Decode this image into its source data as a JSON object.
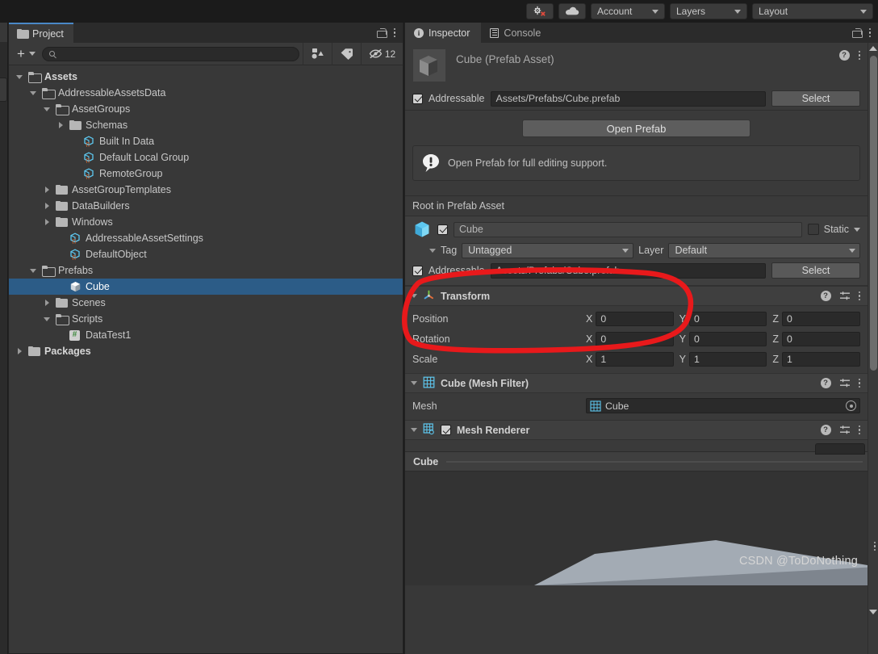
{
  "toolbar": {
    "cloud_icon": "cloud-icon",
    "collab_icon": "collab-error-icon",
    "account_label": "Account",
    "layers_label": "Layers",
    "layout_label": "Layout"
  },
  "project_panel": {
    "tab_label": "Project",
    "tab_icon": "folder-icon",
    "lock_icon": "lock-icon",
    "menu_icon": "kebab-menu-icon",
    "create_label": "+",
    "search": {
      "value": "",
      "placeholder": "",
      "icon": "search-icon"
    },
    "filter_type_icon": "filter-by-type-icon",
    "filter_label_icon": "filter-by-label-icon",
    "hidden_icon": "hidden-eye-icon",
    "hidden_count": "12",
    "tree": [
      {
        "label": "Assets",
        "depth": 0,
        "twisty": "down",
        "icon": "folder-open-icon",
        "bold": true,
        "selected": false
      },
      {
        "label": "AddressableAssetsData",
        "depth": 1,
        "twisty": "down",
        "icon": "folder-open-icon",
        "bold": false,
        "selected": false
      },
      {
        "label": "AssetGroups",
        "depth": 2,
        "twisty": "down",
        "icon": "folder-open-icon",
        "bold": false,
        "selected": false
      },
      {
        "label": "Schemas",
        "depth": 3,
        "twisty": "right",
        "icon": "folder-icon",
        "bold": false,
        "selected": false
      },
      {
        "label": "Built In Data",
        "depth": 4,
        "twisty": "none",
        "icon": "scriptable-object-icon",
        "bold": false,
        "selected": false
      },
      {
        "label": "Default Local Group",
        "depth": 4,
        "twisty": "none",
        "icon": "scriptable-object-icon",
        "bold": false,
        "selected": false
      },
      {
        "label": "RemoteGroup",
        "depth": 4,
        "twisty": "none",
        "icon": "scriptable-object-icon",
        "bold": false,
        "selected": false
      },
      {
        "label": "AssetGroupTemplates",
        "depth": 2,
        "twisty": "right",
        "icon": "folder-icon",
        "bold": false,
        "selected": false
      },
      {
        "label": "DataBuilders",
        "depth": 2,
        "twisty": "right",
        "icon": "folder-icon",
        "bold": false,
        "selected": false
      },
      {
        "label": "Windows",
        "depth": 2,
        "twisty": "right",
        "icon": "folder-icon",
        "bold": false,
        "selected": false
      },
      {
        "label": "AddressableAssetSettings",
        "depth": 3,
        "twisty": "none",
        "icon": "scriptable-object-icon",
        "bold": false,
        "selected": false
      },
      {
        "label": "DefaultObject",
        "depth": 3,
        "twisty": "none",
        "icon": "scriptable-object-icon",
        "bold": false,
        "selected": false
      },
      {
        "label": "Prefabs",
        "depth": 1,
        "twisty": "down",
        "icon": "folder-open-icon",
        "bold": false,
        "selected": false
      },
      {
        "label": "Cube",
        "depth": 3,
        "twisty": "none",
        "icon": "prefab-cube-icon",
        "bold": false,
        "selected": true
      },
      {
        "label": "Scenes",
        "depth": 2,
        "twisty": "right",
        "icon": "folder-icon",
        "bold": false,
        "selected": false
      },
      {
        "label": "Scripts",
        "depth": 2,
        "twisty": "down",
        "icon": "folder-open-icon",
        "bold": false,
        "selected": false
      },
      {
        "label": "DataTest1",
        "depth": 3,
        "twisty": "none",
        "icon": "csharp-script-icon",
        "bold": false,
        "selected": false
      },
      {
        "label": "Packages",
        "depth": 0,
        "twisty": "right",
        "icon": "folder-icon",
        "bold": true,
        "selected": false
      }
    ]
  },
  "inspector": {
    "tabs": [
      {
        "label": "Inspector",
        "icon": "info-icon",
        "active": true
      },
      {
        "label": "Console",
        "icon": "console-icon",
        "active": false
      }
    ],
    "lock_icon": "lock-icon",
    "menu_icon": "kebab-menu-icon",
    "asset_header": {
      "title": "Cube (Prefab Asset)",
      "thumbnail": "cube-thumbnail",
      "help_icon": "help-icon",
      "menu_icon": "kebab-menu-icon"
    },
    "asset_addressable": {
      "checked": true,
      "label": "Addressable",
      "path": "Assets/Prefabs/Cube.prefab",
      "select_label": "Select"
    },
    "prefab_section": {
      "open_prefab_label": "Open Prefab",
      "help_icon": "warning-icon",
      "help_text": "Open Prefab for full editing support."
    },
    "root_label": "Root in Prefab Asset",
    "gameobject": {
      "icon": "prefab-cube-icon",
      "enabled": true,
      "name": "Cube",
      "static_label": "Static",
      "static_checked": false,
      "tag_label": "Tag",
      "tag_value": "Untagged",
      "layer_label": "Layer",
      "layer_value": "Default",
      "addressable": {
        "checked": true,
        "label": "Addressable",
        "path": "Assets/Prefabs/Cube.prefab",
        "select_label": "Select"
      }
    },
    "components": [
      {
        "name": "Transform",
        "icon": "transform-axis-icon",
        "help_icon": "help-icon",
        "preset_icon": "preset-icon",
        "menu_icon": "kebab-menu-icon",
        "rows": [
          {
            "label": "Position",
            "x": "0",
            "y": "0",
            "z": "0"
          },
          {
            "label": "Rotation",
            "x": "0",
            "y": "0",
            "z": "0"
          },
          {
            "label": "Scale",
            "x": "1",
            "y": "1",
            "z": "1"
          }
        ],
        "axis_labels": {
          "x": "X",
          "y": "Y",
          "z": "Z"
        }
      },
      {
        "name": "Cube (Mesh Filter)",
        "icon": "mesh-filter-icon",
        "help_icon": "help-icon",
        "preset_icon": "preset-icon",
        "menu_icon": "kebab-menu-icon",
        "mesh_label": "Mesh",
        "mesh_value": "Cube",
        "mesh_value_icon": "mesh-icon",
        "picker_icon": "object-picker-icon"
      },
      {
        "name": "Mesh Renderer",
        "icon": "mesh-renderer-icon",
        "enabled": true,
        "help_icon": "help-icon",
        "preset_icon": "preset-icon",
        "menu_icon": "kebab-menu-icon"
      }
    ],
    "preview": {
      "title": "Cube",
      "menu_icon": "kebab-menu-icon",
      "watermark": "CSDN @ToDoNothing"
    },
    "scrollbar": {
      "up_icon": "scroll-up-arrow",
      "down_icon": "scroll-down-arrow"
    }
  },
  "annotation": {
    "type": "red-ellipse-highlight",
    "color": "#e8191b"
  }
}
